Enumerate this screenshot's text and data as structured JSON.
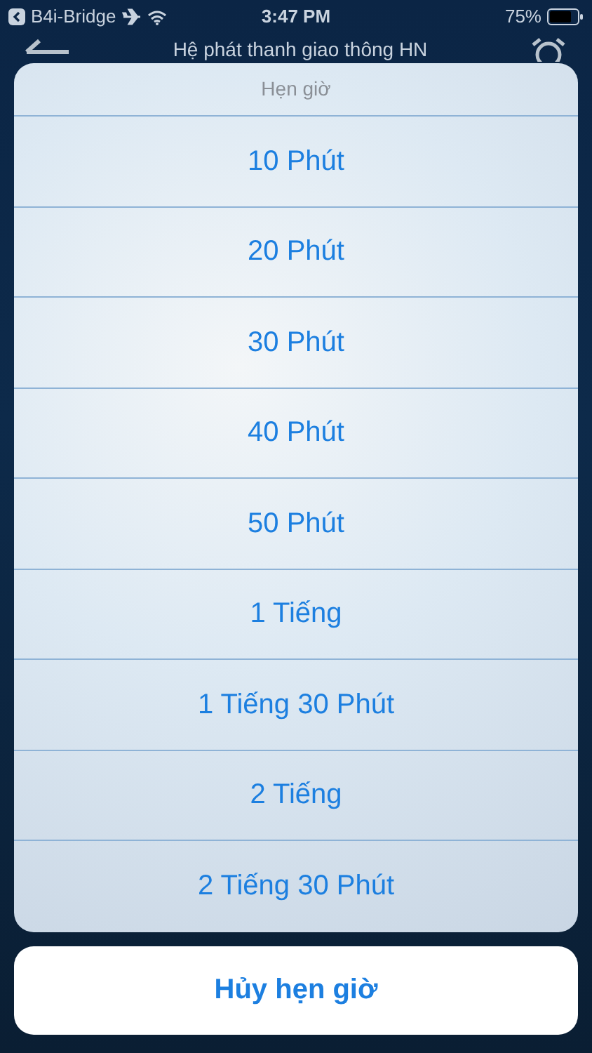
{
  "status_bar": {
    "back_app": "B4i-Bridge",
    "time": "3:47 PM",
    "battery": "75%"
  },
  "nav": {
    "title": "Hệ phát thanh giao thông HN"
  },
  "sheet": {
    "title": "Hẹn giờ",
    "options": [
      {
        "label": "10 Phút"
      },
      {
        "label": "20 Phút"
      },
      {
        "label": "30 Phút"
      },
      {
        "label": "40 Phút"
      },
      {
        "label": "50 Phút"
      },
      {
        "label": "1 Tiếng"
      },
      {
        "label": "1 Tiếng 30 Phút"
      },
      {
        "label": "2 Tiếng"
      },
      {
        "label": "2 Tiếng 30 Phút"
      }
    ]
  },
  "cancel": {
    "label": "Hủy hẹn giờ"
  }
}
